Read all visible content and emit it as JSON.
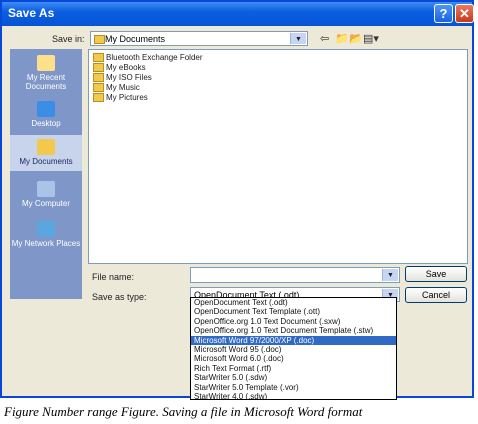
{
  "window": {
    "title": "Save As"
  },
  "save_in": {
    "label": "Save in:",
    "value": "My Documents"
  },
  "toolbar": {
    "back_icon": "back-arrow-icon",
    "up_icon": "up-folder-icon",
    "new_icon": "new-folder-icon",
    "views_icon": "views-menu-icon"
  },
  "places": [
    {
      "label": "My Recent Documents",
      "icon": "recent-documents-icon"
    },
    {
      "label": "Desktop",
      "icon": "desktop-icon"
    },
    {
      "label": "My Documents",
      "icon": "my-documents-icon"
    },
    {
      "label": "My Computer",
      "icon": "my-computer-icon"
    },
    {
      "label": "My Network Places",
      "icon": "network-places-icon"
    }
  ],
  "files": [
    "Bluetooth Exchange Folder",
    "My eBooks",
    "My ISO Files",
    "My Music",
    "My Pictures"
  ],
  "file_name": {
    "label": "File name:",
    "value": ""
  },
  "save_as_type": {
    "label": "Save as type:",
    "value": "OpenDocument Text (.odt)",
    "options": [
      "OpenDocument Text (.odt)",
      "OpenDocument Text Template (.ott)",
      "OpenOffice.org 1.0 Text Document (.sxw)",
      "OpenOffice.org 1.0 Text Document Template (.stw)",
      "Microsoft Word 97/2000/XP (.doc)",
      "Microsoft Word 95 (.doc)",
      "Microsoft Word 6.0 (.doc)",
      "Rich Text Format (.rtf)",
      "StarWriter 5.0 (.sdw)",
      "StarWriter 5.0 Template (.vor)",
      "StarWriter 4.0 (.sdw)"
    ],
    "selected_index": 4
  },
  "buttons": {
    "save": "Save",
    "cancel": "Cancel"
  },
  "caption": "Figure Number range Figure. Saving a file in Microsoft Word format",
  "colors": {
    "titlebar": "#0a5fe0",
    "selection": "#316ac5",
    "dialog_bg": "#ece9d8"
  }
}
